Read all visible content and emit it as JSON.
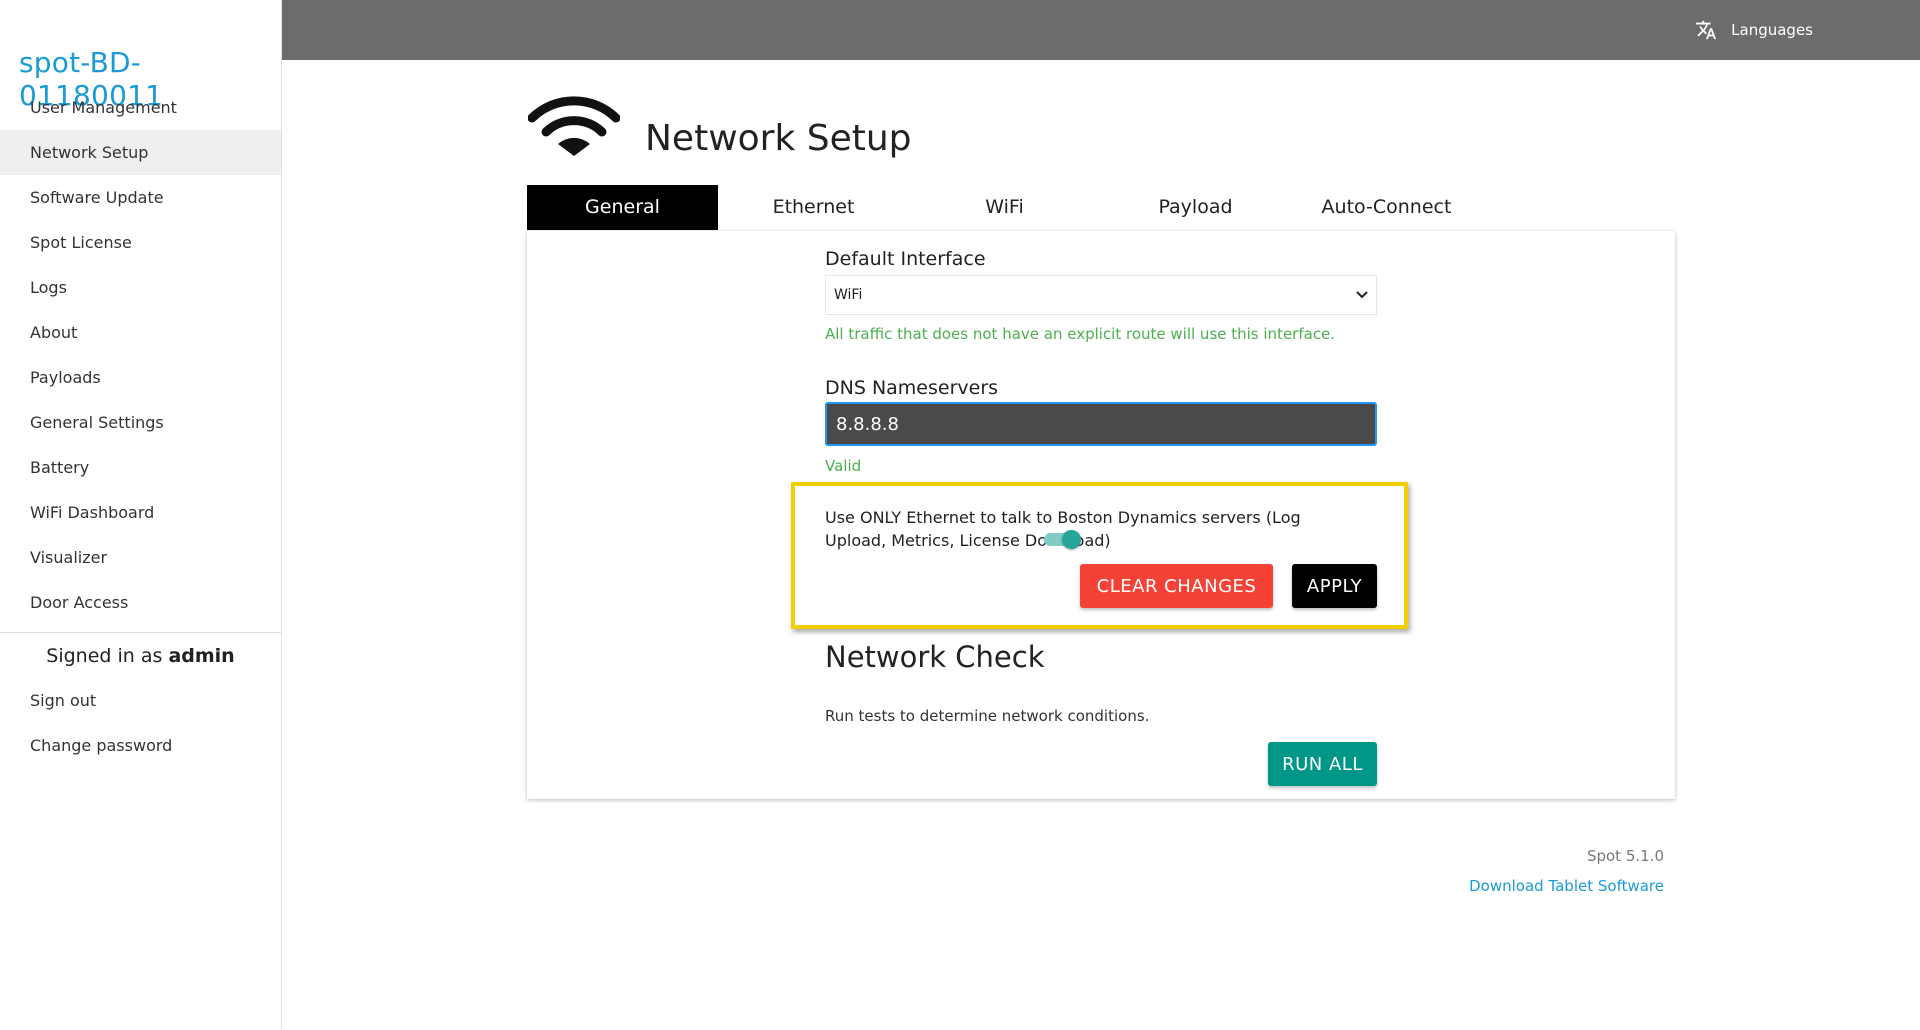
{
  "sidebar": {
    "robot_name": "spot-BD-01180011",
    "items": [
      {
        "label": "User Management"
      },
      {
        "label": "Network Setup"
      },
      {
        "label": "Software Update"
      },
      {
        "label": "Spot License"
      },
      {
        "label": "Logs"
      },
      {
        "label": "About"
      },
      {
        "label": "Payloads"
      },
      {
        "label": "General Settings"
      },
      {
        "label": "Battery"
      },
      {
        "label": "WiFi Dashboard"
      },
      {
        "label": "Visualizer"
      },
      {
        "label": "Door Access"
      }
    ],
    "active_item": "Network Setup",
    "signed_in_prefix": "Signed in as",
    "signed_in_user": "admin",
    "account_items": [
      {
        "label": "Sign out"
      },
      {
        "label": "Change password"
      }
    ]
  },
  "topbar": {
    "languages_label": "Languages",
    "languages_icon": "translate-icon"
  },
  "page": {
    "icon": "wifi-icon",
    "title": "Network Setup",
    "tabs": [
      {
        "label": "General"
      },
      {
        "label": "Ethernet"
      },
      {
        "label": "WiFi"
      },
      {
        "label": "Payload"
      },
      {
        "label": "Auto-Connect"
      }
    ],
    "active_tab": "General"
  },
  "general": {
    "default_interface_label": "Default Interface",
    "default_interface_value": "WiFi",
    "default_interface_hint": "All traffic that does not have an explicit route will use this interface.",
    "dns_label": "DNS Nameservers",
    "dns_value": "8.8.8.8",
    "dns_status": "Valid",
    "ethernet_only_text": "Use ONLY Ethernet to talk to Boston Dynamics servers (Log Upload, Metrics, License Download)",
    "ethernet_only_enabled": true,
    "clear_label": "CLEAR CHANGES",
    "apply_label": "APPLY"
  },
  "network_check": {
    "title": "Network Check",
    "description": "Run tests to determine network conditions.",
    "run_all_label": "RUN ALL"
  },
  "footer": {
    "version": "Spot 5.1.0",
    "download_link": "Download Tablet Software"
  },
  "colors": {
    "accent_blue": "#1a9ad6",
    "topbar": "#6c6c6c",
    "success_green": "#4caf50",
    "danger_red": "#f44336",
    "teal": "#009688",
    "highlight_yellow": "#f2cf00"
  }
}
